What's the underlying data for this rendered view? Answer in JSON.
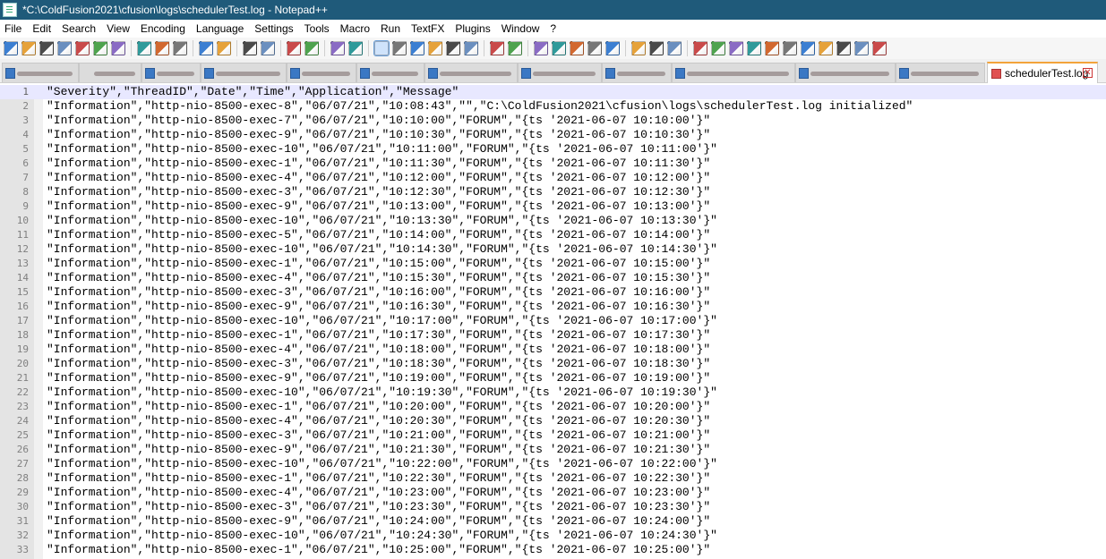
{
  "window": {
    "title": "*C:\\ColdFusion2021\\cfusion\\logs\\schedulerTest.log - Notepad++"
  },
  "menu": [
    "File",
    "Edit",
    "Search",
    "View",
    "Encoding",
    "Language",
    "Settings",
    "Tools",
    "Macro",
    "Run",
    "TextFX",
    "Plugins",
    "Window",
    "?"
  ],
  "toolbar_icons": [
    "new-file-icon",
    "open-file-icon",
    "save-icon",
    "save-all-icon",
    "close-icon",
    "close-all-icon",
    "print-icon",
    "cut-icon",
    "copy-icon",
    "paste-icon",
    "undo-icon",
    "redo-icon",
    "find-icon",
    "replace-icon",
    "zoom-in-icon",
    "zoom-out-icon",
    "sync-vertical-icon",
    "sync-horizontal-icon",
    "word-wrap-icon",
    "show-all-chars-icon",
    "indent-guide-icon",
    "udl-icon",
    "doc-map-icon",
    "function-list-icon",
    "folder-workspace-icon",
    "monitor-icon",
    "record-macro-icon",
    "stop-record-icon",
    "play-macro-icon",
    "play-multiple-icon",
    "save-macro-icon",
    "prev-icon",
    "bookmark-icon",
    "next-icon",
    "plugin-a-icon",
    "plugin-b-icon",
    "plugin-c-icon",
    "plugin-d-icon",
    "plugin-e-icon",
    "plugin-f-icon",
    "plugin-g-icon",
    "html-tag-icon",
    "json-icon",
    "clipboard-icon",
    "spellcheck-icon"
  ],
  "tabs": {
    "active_label": "schedulerTest.log"
  },
  "editor": {
    "lines": [
      {
        "n": "1",
        "t": "\"Severity\",\"ThreadID\",\"Date\",\"Time\",\"Application\",\"Message\""
      },
      {
        "n": "2",
        "t": "\"Information\",\"http-nio-8500-exec-8\",\"06/07/21\",\"10:08:43\",\"\",\"C:\\ColdFusion2021\\cfusion\\logs\\schedulerTest.log initialized\""
      },
      {
        "n": "3",
        "t": "\"Information\",\"http-nio-8500-exec-7\",\"06/07/21\",\"10:10:00\",\"FORUM\",\"{ts '2021-06-07 10:10:00'}\""
      },
      {
        "n": "4",
        "t": "\"Information\",\"http-nio-8500-exec-9\",\"06/07/21\",\"10:10:30\",\"FORUM\",\"{ts '2021-06-07 10:10:30'}\""
      },
      {
        "n": "5",
        "t": "\"Information\",\"http-nio-8500-exec-10\",\"06/07/21\",\"10:11:00\",\"FORUM\",\"{ts '2021-06-07 10:11:00'}\""
      },
      {
        "n": "6",
        "t": "\"Information\",\"http-nio-8500-exec-1\",\"06/07/21\",\"10:11:30\",\"FORUM\",\"{ts '2021-06-07 10:11:30'}\""
      },
      {
        "n": "7",
        "t": "\"Information\",\"http-nio-8500-exec-4\",\"06/07/21\",\"10:12:00\",\"FORUM\",\"{ts '2021-06-07 10:12:00'}\""
      },
      {
        "n": "8",
        "t": "\"Information\",\"http-nio-8500-exec-3\",\"06/07/21\",\"10:12:30\",\"FORUM\",\"{ts '2021-06-07 10:12:30'}\""
      },
      {
        "n": "9",
        "t": "\"Information\",\"http-nio-8500-exec-9\",\"06/07/21\",\"10:13:00\",\"FORUM\",\"{ts '2021-06-07 10:13:00'}\""
      },
      {
        "n": "10",
        "t": "\"Information\",\"http-nio-8500-exec-10\",\"06/07/21\",\"10:13:30\",\"FORUM\",\"{ts '2021-06-07 10:13:30'}\""
      },
      {
        "n": "11",
        "t": "\"Information\",\"http-nio-8500-exec-5\",\"06/07/21\",\"10:14:00\",\"FORUM\",\"{ts '2021-06-07 10:14:00'}\""
      },
      {
        "n": "12",
        "t": "\"Information\",\"http-nio-8500-exec-10\",\"06/07/21\",\"10:14:30\",\"FORUM\",\"{ts '2021-06-07 10:14:30'}\""
      },
      {
        "n": "13",
        "t": "\"Information\",\"http-nio-8500-exec-1\",\"06/07/21\",\"10:15:00\",\"FORUM\",\"{ts '2021-06-07 10:15:00'}\""
      },
      {
        "n": "14",
        "t": "\"Information\",\"http-nio-8500-exec-4\",\"06/07/21\",\"10:15:30\",\"FORUM\",\"{ts '2021-06-07 10:15:30'}\""
      },
      {
        "n": "15",
        "t": "\"Information\",\"http-nio-8500-exec-3\",\"06/07/21\",\"10:16:00\",\"FORUM\",\"{ts '2021-06-07 10:16:00'}\""
      },
      {
        "n": "16",
        "t": "\"Information\",\"http-nio-8500-exec-9\",\"06/07/21\",\"10:16:30\",\"FORUM\",\"{ts '2021-06-07 10:16:30'}\""
      },
      {
        "n": "17",
        "t": "\"Information\",\"http-nio-8500-exec-10\",\"06/07/21\",\"10:17:00\",\"FORUM\",\"{ts '2021-06-07 10:17:00'}\""
      },
      {
        "n": "18",
        "t": "\"Information\",\"http-nio-8500-exec-1\",\"06/07/21\",\"10:17:30\",\"FORUM\",\"{ts '2021-06-07 10:17:30'}\""
      },
      {
        "n": "19",
        "t": "\"Information\",\"http-nio-8500-exec-4\",\"06/07/21\",\"10:18:00\",\"FORUM\",\"{ts '2021-06-07 10:18:00'}\""
      },
      {
        "n": "20",
        "t": "\"Information\",\"http-nio-8500-exec-3\",\"06/07/21\",\"10:18:30\",\"FORUM\",\"{ts '2021-06-07 10:18:30'}\""
      },
      {
        "n": "21",
        "t": "\"Information\",\"http-nio-8500-exec-9\",\"06/07/21\",\"10:19:00\",\"FORUM\",\"{ts '2021-06-07 10:19:00'}\""
      },
      {
        "n": "22",
        "t": "\"Information\",\"http-nio-8500-exec-10\",\"06/07/21\",\"10:19:30\",\"FORUM\",\"{ts '2021-06-07 10:19:30'}\""
      },
      {
        "n": "23",
        "t": "\"Information\",\"http-nio-8500-exec-1\",\"06/07/21\",\"10:20:00\",\"FORUM\",\"{ts '2021-06-07 10:20:00'}\""
      },
      {
        "n": "24",
        "t": "\"Information\",\"http-nio-8500-exec-4\",\"06/07/21\",\"10:20:30\",\"FORUM\",\"{ts '2021-06-07 10:20:30'}\""
      },
      {
        "n": "25",
        "t": "\"Information\",\"http-nio-8500-exec-3\",\"06/07/21\",\"10:21:00\",\"FORUM\",\"{ts '2021-06-07 10:21:00'}\""
      },
      {
        "n": "26",
        "t": "\"Information\",\"http-nio-8500-exec-9\",\"06/07/21\",\"10:21:30\",\"FORUM\",\"{ts '2021-06-07 10:21:30'}\""
      },
      {
        "n": "27",
        "t": "\"Information\",\"http-nio-8500-exec-10\",\"06/07/21\",\"10:22:00\",\"FORUM\",\"{ts '2021-06-07 10:22:00'}\""
      },
      {
        "n": "28",
        "t": "\"Information\",\"http-nio-8500-exec-1\",\"06/07/21\",\"10:22:30\",\"FORUM\",\"{ts '2021-06-07 10:22:30'}\""
      },
      {
        "n": "29",
        "t": "\"Information\",\"http-nio-8500-exec-4\",\"06/07/21\",\"10:23:00\",\"FORUM\",\"{ts '2021-06-07 10:23:00'}\""
      },
      {
        "n": "30",
        "t": "\"Information\",\"http-nio-8500-exec-3\",\"06/07/21\",\"10:23:30\",\"FORUM\",\"{ts '2021-06-07 10:23:30'}\""
      },
      {
        "n": "31",
        "t": "\"Information\",\"http-nio-8500-exec-9\",\"06/07/21\",\"10:24:00\",\"FORUM\",\"{ts '2021-06-07 10:24:00'}\""
      },
      {
        "n": "32",
        "t": "\"Information\",\"http-nio-8500-exec-10\",\"06/07/21\",\"10:24:30\",\"FORUM\",\"{ts '2021-06-07 10:24:30'}\""
      },
      {
        "n": "33",
        "t": "\"Information\",\"http-nio-8500-exec-1\",\"06/07/21\",\"10:25:00\",\"FORUM\",\"{ts '2021-06-07 10:25:00'}\""
      }
    ]
  }
}
